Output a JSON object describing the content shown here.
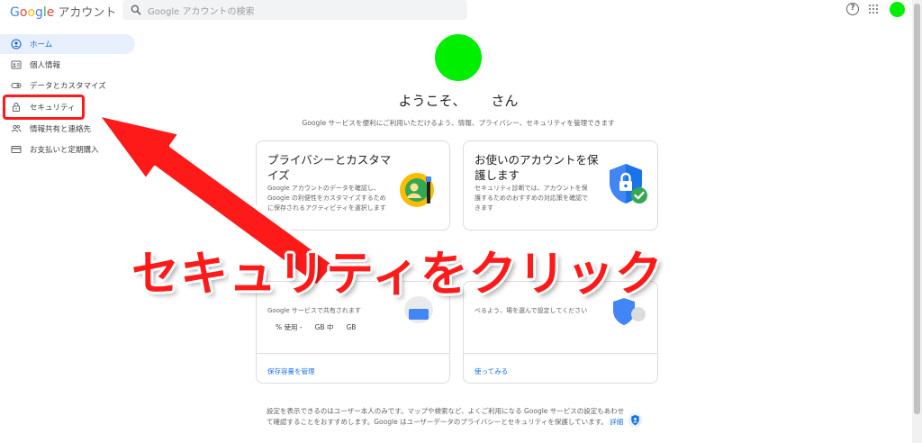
{
  "header": {
    "logo_letters": [
      "G",
      "o",
      "o",
      "g",
      "l",
      "e"
    ],
    "product": "アカウント",
    "search_placeholder": "Google アカウントの検索",
    "help_glyph": "?"
  },
  "sidebar": {
    "items": [
      {
        "label": "ホーム",
        "icon": "home-person-icon",
        "active": true
      },
      {
        "label": "個人情報",
        "icon": "id-card-icon",
        "active": false
      },
      {
        "label": "データとカスタマイズ",
        "icon": "toggle-icon",
        "active": false
      },
      {
        "label": "セキュリティ",
        "icon": "lock-icon",
        "active": false
      },
      {
        "label": "情報共有と連絡先",
        "icon": "people-icon",
        "active": false
      },
      {
        "label": "お支払いと定期購入",
        "icon": "credit-card-icon",
        "active": false
      }
    ]
  },
  "main": {
    "welcome_prefix": "ようこそ、",
    "welcome_suffix": "さん",
    "subtitle": "Google サービスを便利にご利用いただけるよう、情報、プライバシー、セキュリティを管理できます",
    "cards": [
      {
        "title": "プライバシーとカスタマイズ",
        "desc": "Google アカウントのデータを確認し、Google の利便性をカスタマイズするために保存されるアクティビティを選択します",
        "illustration": "privacy-illustration-icon"
      },
      {
        "title": "お使いのアカウントを保護します",
        "desc": "セキュリティ診断では、アカウントを保護するためのおすすめの対応策を確認できます",
        "illustration": "security-shield-icon"
      }
    ],
    "storage_card": {
      "desc_fragment": "Google サービスで共有されます",
      "usage_percent": "% 使用 -",
      "usage_gb1": "GB 中",
      "usage_gb2": "GB",
      "link": "保存容量を管理"
    },
    "checkup_card": {
      "desc_fragment": "べるよう、場を選んで設定してください",
      "link": "使ってみる"
    },
    "footer": {
      "text": "設定を表示できるのはユーザー本人のみです。マップや検索など、よくご利用になる Google サービスの設定もあわせて確認することをおすすめします。Google はユーザーデータのプライバシーとセキュリティを保護しています。",
      "more": "詳細"
    }
  },
  "overlay": {
    "instruction": "セキュリティをクリック",
    "color": "#ff1a1a"
  },
  "colors": {
    "avatar": "#00ee00",
    "accent": "#1a73e8",
    "nav_active_bg": "#e8f0fe",
    "highlight": "#ff1a1a"
  }
}
